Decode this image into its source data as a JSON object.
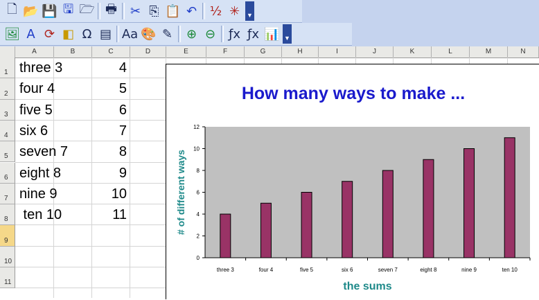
{
  "toolbar1": [
    {
      "name": "new-document-icon",
      "glyph": "🗋"
    },
    {
      "name": "open-folder-icon",
      "glyph": "📂"
    },
    {
      "name": "save-icon",
      "glyph": "💾"
    },
    {
      "name": "save-as-icon",
      "glyph": "🖫"
    },
    {
      "name": "export-icon",
      "glyph": "🗁"
    },
    {
      "sep": true
    },
    {
      "name": "print-icon",
      "glyph": "🖶"
    },
    {
      "sep": true
    },
    {
      "name": "cut-icon",
      "glyph": "✂"
    },
    {
      "name": "copy-icon",
      "glyph": "⎘"
    },
    {
      "name": "paste-icon",
      "glyph": "📋"
    },
    {
      "name": "undo-icon",
      "glyph": "↶"
    },
    {
      "sep": true
    },
    {
      "name": "number-format-icon",
      "glyph": "½"
    },
    {
      "name": "magic-tools-icon",
      "glyph": "✳"
    }
  ],
  "toolbar2": [
    {
      "name": "insert-picture-icon",
      "glyph": "🖼"
    },
    {
      "name": "text-art-icon",
      "glyph": "A"
    },
    {
      "name": "rotate-icon",
      "glyph": "⟳"
    },
    {
      "name": "shapes-icon",
      "glyph": "◧"
    },
    {
      "name": "insert-symbol-icon",
      "glyph": "Ω"
    },
    {
      "name": "text-box-icon",
      "glyph": "▤"
    },
    {
      "sep": true
    },
    {
      "name": "font-size-icon",
      "glyph": "Aa"
    },
    {
      "name": "color-palette-icon",
      "glyph": "🎨"
    },
    {
      "name": "properties-icon",
      "glyph": "✎"
    },
    {
      "sep": true
    },
    {
      "name": "zoom-in-icon",
      "glyph": "⊕"
    },
    {
      "name": "zoom-out-icon",
      "glyph": "⊖"
    },
    {
      "sep": true
    },
    {
      "name": "function-wizard-icon",
      "glyph": "ƒx"
    },
    {
      "name": "function-icon",
      "glyph": "ƒx"
    },
    {
      "name": "insert-chart-icon",
      "glyph": "📊"
    }
  ],
  "columns": [
    "A",
    "B",
    "C",
    "D",
    "E",
    "F",
    "G",
    "H",
    "I",
    "J",
    "K",
    "L",
    "M",
    "N"
  ],
  "rows": [
    "1",
    "2",
    "3",
    "4",
    "5",
    "6",
    "7",
    "8",
    "9",
    "10",
    "11"
  ],
  "selected_row": "9",
  "cells": [
    {
      "a": "three 3",
      "c": "4"
    },
    {
      "a": "four 4",
      "c": "5"
    },
    {
      "a": "five 5",
      "c": "6"
    },
    {
      "a": "six 6",
      "c": "7"
    },
    {
      "a": "seven 7",
      "c": "8"
    },
    {
      "a": "eight 8",
      "c": "9"
    },
    {
      "a": "nine 9",
      "c": "10"
    },
    {
      "a": " ten 10",
      "c": "11"
    }
  ],
  "chart_data": {
    "type": "bar",
    "title": "How many ways  to make ...",
    "xlabel": "the sums",
    "ylabel": "# of different ways",
    "categories": [
      "three 3",
      "four 4",
      "five 5",
      "six 6",
      "seven 7",
      "eight 8",
      "nine 9",
      "ten 10"
    ],
    "values": [
      4,
      5,
      6,
      7,
      8,
      9,
      10,
      11
    ],
    "ylim": [
      0,
      12
    ],
    "yticks": [
      0,
      2,
      4,
      6,
      8,
      10,
      12
    ],
    "grid": false,
    "plot_color": "#c0c0c0",
    "bar_color": "#993366",
    "title_color": "#1a1acc",
    "axis_label_color": "#1f8a8a"
  }
}
